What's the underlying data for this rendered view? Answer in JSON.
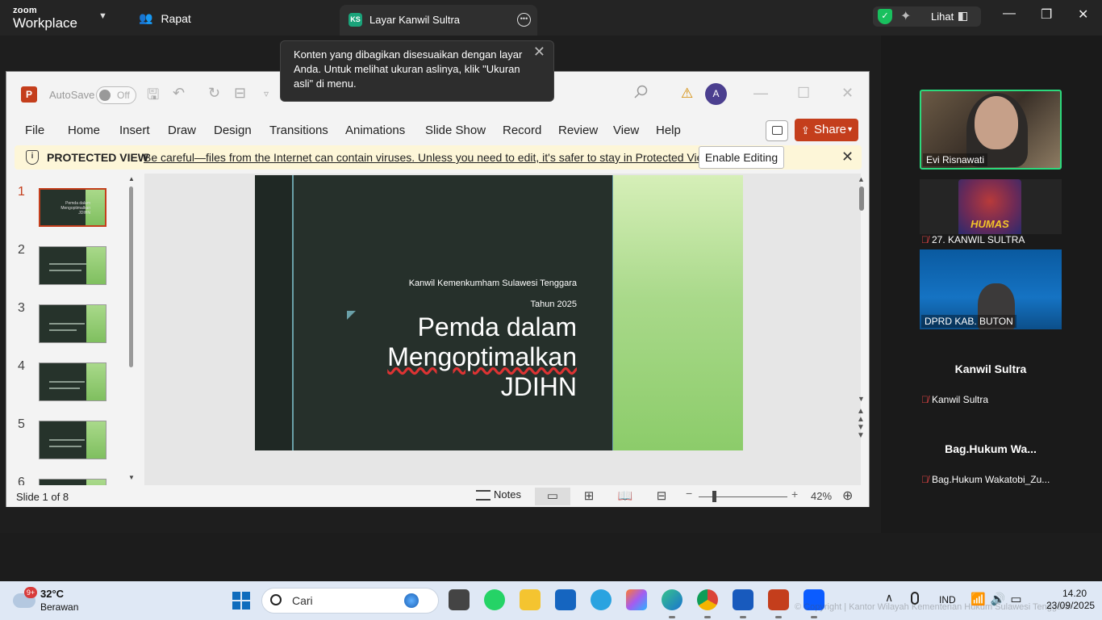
{
  "zoom": {
    "brand_small": "zoom",
    "brand_big": "Workplace",
    "meeting_label": "Rapat",
    "share_tab": {
      "badge": "KS",
      "title": "Layar Kanwil Sultra"
    },
    "view_label": "Lihat",
    "toast": "Konten yang dibagikan disesuaikan dengan layar Anda. Untuk melihat ukuran aslinya, klik \"Ukuran asli\" di menu."
  },
  "ppt": {
    "logo": "P",
    "autosave_label": "AutoSave",
    "autosave_state": "Off",
    "avatar_initial": "A",
    "tabs": [
      "File",
      "Home",
      "Insert",
      "Draw",
      "Design",
      "Transitions",
      "Animations",
      "Slide Show",
      "Record",
      "Review",
      "View",
      "Help"
    ],
    "share_label": "Share",
    "protected_view": {
      "title": "PROTECTED VIEW",
      "message": "Be careful—files from the Internet can contain viruses. Unless you need to edit, it's safer to stay in Protected View.",
      "button": "Enable Editing"
    },
    "thumb_numbers": [
      "1",
      "2",
      "3",
      "4",
      "5",
      "6"
    ],
    "slide": {
      "org": "Kanwil Kemenkumham Sulawesi Tenggara",
      "year": "Tahun 2025",
      "title_line1": "Pemda dalam",
      "title_line2": "Mengoptimalkan",
      "title_line3": "JDIHN"
    },
    "status": {
      "slide_of": "Slide 1 of 8",
      "notes": "Notes",
      "zoom_pct": "42%"
    }
  },
  "participants": [
    {
      "name": "Evi Risnawati"
    },
    {
      "name": "27. KANWIL SULTRA",
      "logo_text": "HUMAS"
    },
    {
      "name": "DPRD KAB. BUTON"
    },
    {
      "display": "Kanwil Sultra",
      "label": "Kanwil Sultra"
    },
    {
      "display": "Bag.Hukum  Wa...",
      "label": "Bag.Hukum Wakatobi_Zu..."
    }
  ],
  "taskbar": {
    "weather_badge": "9+",
    "temperature": "32°C",
    "condition": "Berawan",
    "search_placeholder": "Cari",
    "language": "IND",
    "time": "14.20",
    "date": "23/09/2025",
    "watermark": "© Copyright | Kantor Wilayah Kementerian Hukum Sulawesi Tenggara"
  }
}
